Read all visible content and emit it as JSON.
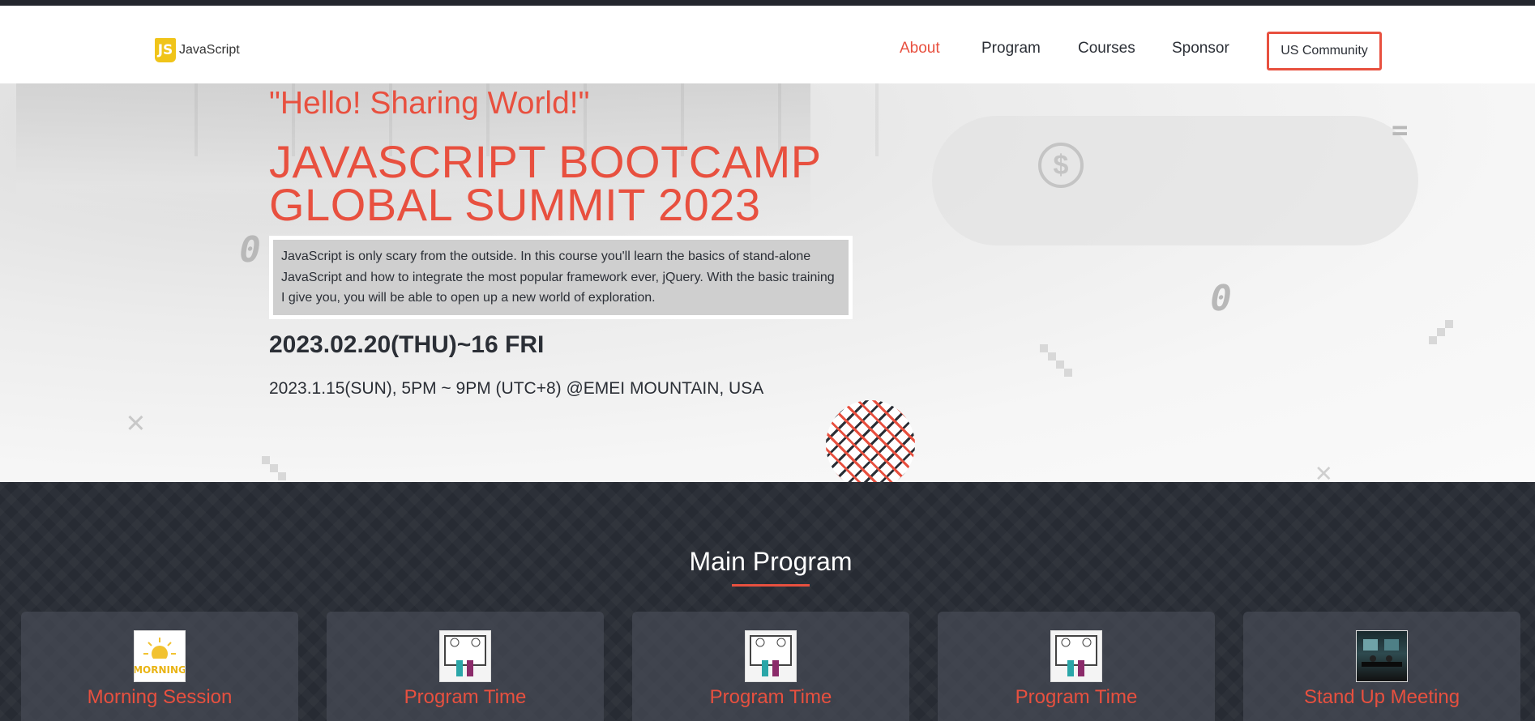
{
  "header": {
    "logo_badge": "JS",
    "logo_text": "JavaScript",
    "nav": [
      {
        "label": "About",
        "active": true
      },
      {
        "label": "Program",
        "active": false
      },
      {
        "label": "Courses",
        "active": false
      },
      {
        "label": "Sponsor",
        "active": false
      }
    ],
    "cta_label": "US Community"
  },
  "hero": {
    "tagline": "\"Hello! Sharing World!\"",
    "title_line1": "JAVASCRIPT BOOTCAMP",
    "title_line2": "GLOBAL SUMMIT 2023",
    "description": "JavaScript is only scary from the outside. In this course you'll learn the basics of stand-alone JavaScript and how to integrate the most popular framework ever, jQuery. With the basic training I give you, you will be able to open up a new world of exploration.",
    "date": "2023.02.20(THU)~16 FRI",
    "location": "2023.1.15(SUN), 5PM ~ 9PM (UTC+8) @EMEI MOUNTAIN, USA"
  },
  "program": {
    "title": "Main Program",
    "cards": [
      {
        "title": "Morning Session",
        "image": "morning-image",
        "image_text": "MORNING"
      },
      {
        "title": "Program Time",
        "image": "comic-image"
      },
      {
        "title": "Program Time",
        "image": "comic-image"
      },
      {
        "title": "Program Time",
        "image": "comic-image"
      },
      {
        "title": "Stand Up Meeting",
        "image": "meeting-image"
      }
    ]
  },
  "colors": {
    "accent": "#e8503f",
    "dark": "#23262d",
    "logo_yellow": "#f0c419"
  }
}
